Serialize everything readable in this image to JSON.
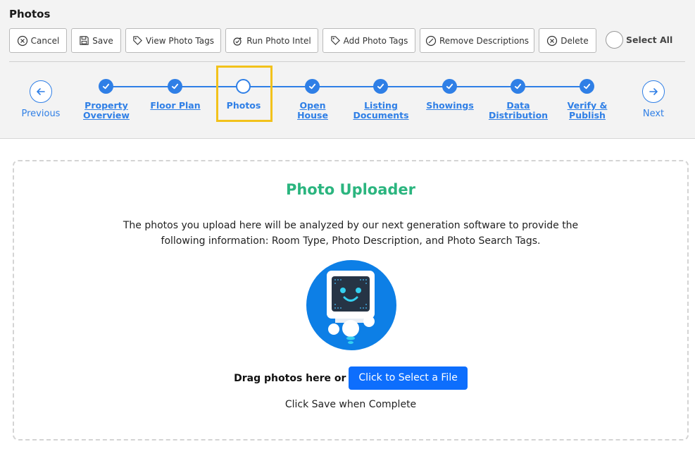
{
  "page": {
    "title": "Photos"
  },
  "toolbar": {
    "cancel": "Cancel",
    "save": "Save",
    "view_tags": "View Photo Tags",
    "run_intel": "Run Photo Intel",
    "add_tags": "Add Photo Tags",
    "remove_desc": "Remove Descriptions",
    "delete": "Delete",
    "select_all": "Select All"
  },
  "stepper": {
    "previous": "Previous",
    "next": "Next",
    "current": "Photos",
    "steps": [
      {
        "line1": "Property",
        "line2": "Overview",
        "state": "complete"
      },
      {
        "line1": "Floor Plan",
        "line2": "",
        "state": "complete"
      },
      {
        "line1": "Photos",
        "line2": "",
        "state": "current"
      },
      {
        "line1": "Open",
        "line2": "House",
        "state": "complete"
      },
      {
        "line1": "Listing",
        "line2": "Documents",
        "state": "complete"
      },
      {
        "line1": "Showings",
        "line2": "",
        "state": "complete"
      },
      {
        "line1": "Data",
        "line2": "Distribution",
        "state": "complete"
      },
      {
        "line1": "Verify &",
        "line2": "Publish",
        "state": "complete"
      }
    ]
  },
  "uploader": {
    "title": "Photo Uploader",
    "description": "The photos you upload here will be analyzed by our next generation software to provide the following information: Room Type, Photo Description, and Photo Search Tags.",
    "drag_text": "Drag photos here or",
    "select_button": "Click to Select a File",
    "save_note": "Click Save when Complete"
  },
  "colors": {
    "accent": "#2f7fe6",
    "title_green": "#2bb57f",
    "highlight": "#f2c21b",
    "button_blue": "#0d6efd"
  },
  "icons": [
    "cancel-icon",
    "save-icon",
    "tag-icon",
    "run-intel-icon",
    "tag-icon",
    "remove-icon",
    "delete-icon",
    "arrow-left-icon",
    "arrow-right-icon",
    "check-icon",
    "robot-icon"
  ]
}
